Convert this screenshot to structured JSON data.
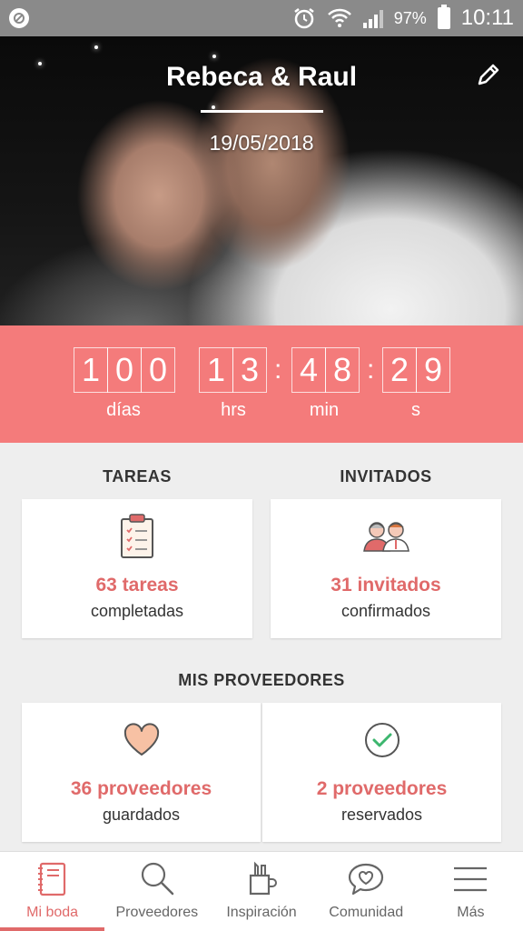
{
  "status_bar": {
    "battery": "97%",
    "time": "10:11"
  },
  "header": {
    "names": "Rebeca & Raul",
    "date": "19/05/2018"
  },
  "countdown": {
    "days": [
      "1",
      "0",
      "0"
    ],
    "hours": [
      "1",
      "3"
    ],
    "minutes": [
      "4",
      "8"
    ],
    "seconds": [
      "2",
      "9"
    ],
    "separator": ":",
    "labels": {
      "days": "días",
      "hours": "hrs",
      "minutes": "min",
      "seconds": "s"
    }
  },
  "tasks": {
    "title": "TAREAS",
    "count": "63 tareas",
    "sub": "completadas"
  },
  "guests": {
    "title": "INVITADOS",
    "count": "31 invitados",
    "sub": "confirmados"
  },
  "providers": {
    "title": "MIS PROVEEDORES",
    "saved": {
      "count": "36 proveedores",
      "sub": "guardados"
    },
    "booked": {
      "count": "2 proveedores",
      "sub": "reservados"
    }
  },
  "nav": [
    {
      "label": "Mi boda",
      "icon": "notebook-icon"
    },
    {
      "label": "Proveedores",
      "icon": "search-icon"
    },
    {
      "label": "Inspiración",
      "icon": "pencil-cup-icon"
    },
    {
      "label": "Comunidad",
      "icon": "chat-heart-icon"
    },
    {
      "label": "Más",
      "icon": "menu-icon"
    }
  ],
  "colors": {
    "accent": "#f47b7b",
    "accent_text": "#e06a6a"
  }
}
